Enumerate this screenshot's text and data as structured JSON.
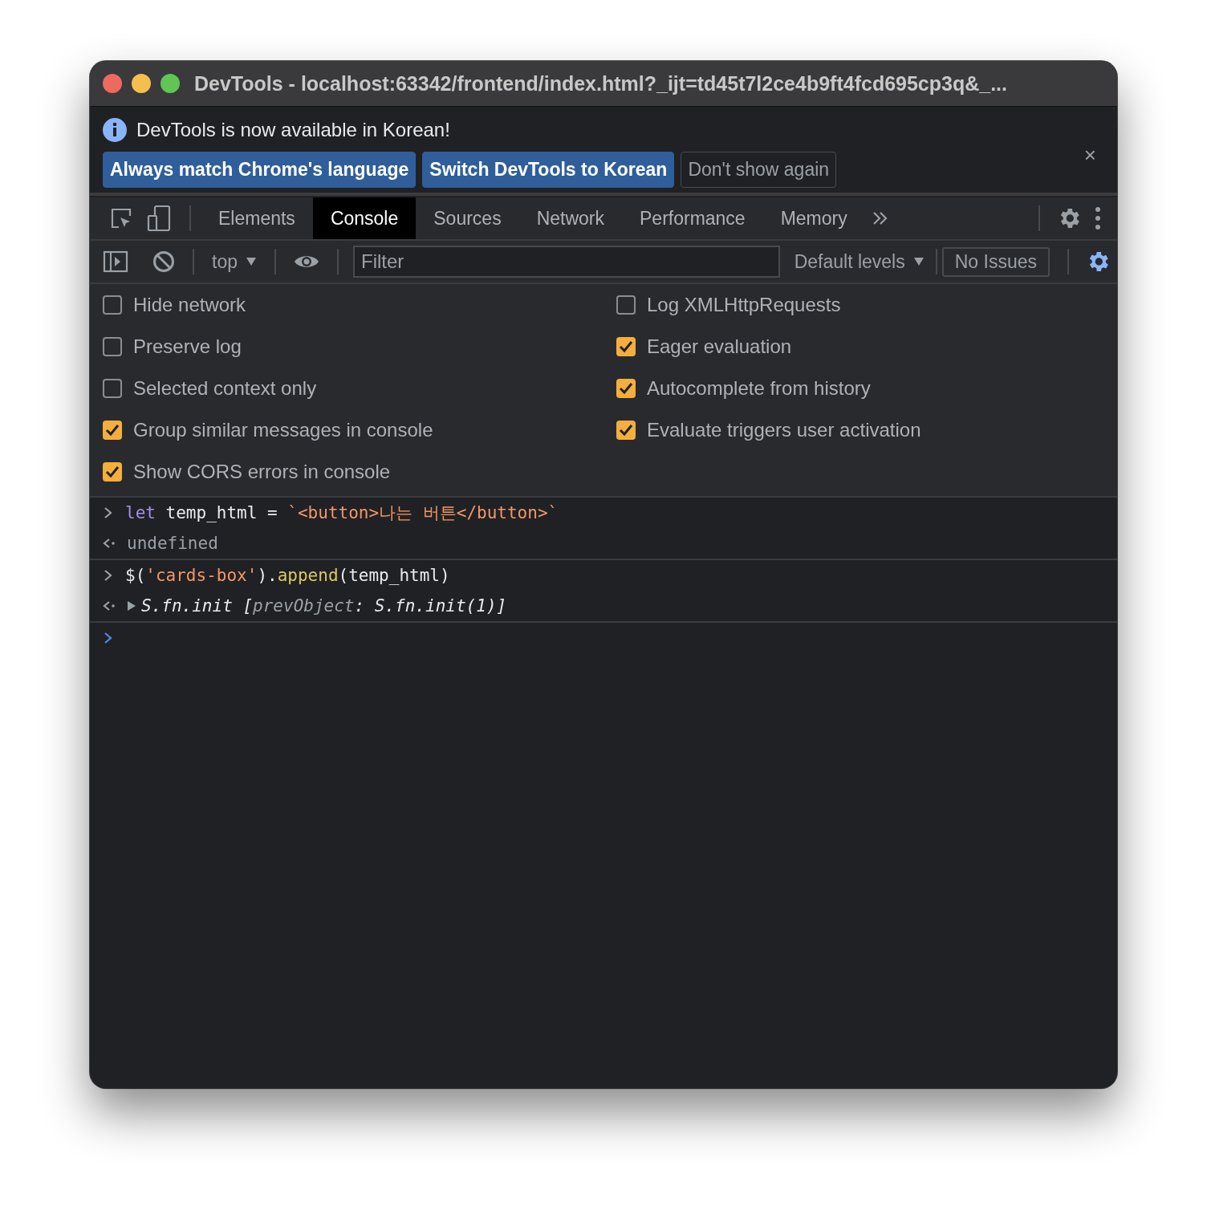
{
  "window": {
    "title": "DevTools - localhost:63342/frontend/index.html?_ijt=td45t7l2ce4b9ft4fcd695cp3q&_..."
  },
  "infobar": {
    "message": "DevTools is now available in Korean!",
    "buttons": [
      {
        "label": "Always match Chrome's language",
        "kind": "primary"
      },
      {
        "label": "Switch DevTools to Korean",
        "kind": "primary"
      },
      {
        "label": "Don't show again",
        "kind": "secondary"
      }
    ],
    "close": "×"
  },
  "tabs": [
    {
      "label": "Elements",
      "selected": false
    },
    {
      "label": "Console",
      "selected": true
    },
    {
      "label": "Sources",
      "selected": false
    },
    {
      "label": "Network",
      "selected": false
    },
    {
      "label": "Performance",
      "selected": false
    },
    {
      "label": "Memory",
      "selected": false
    }
  ],
  "toolbar": {
    "context": "top",
    "filter": {
      "placeholder": "Filter"
    },
    "levels": "Default levels",
    "issues": "No Issues"
  },
  "settings": {
    "left": [
      {
        "label": "Hide network",
        "checked": false
      },
      {
        "label": "Preserve log",
        "checked": false
      },
      {
        "label": "Selected context only",
        "checked": false
      },
      {
        "label": "Group similar messages in console",
        "checked": true
      },
      {
        "label": "Show CORS errors in console",
        "checked": true
      }
    ],
    "right": [
      {
        "label": "Log XMLHttpRequests",
        "checked": false
      },
      {
        "label": "Eager evaluation",
        "checked": true
      },
      {
        "label": "Autocomplete from history",
        "checked": true
      },
      {
        "label": "Evaluate triggers user activation",
        "checked": true
      }
    ]
  },
  "console": [
    {
      "kind": "input",
      "tokens": [
        {
          "kind": "keyword",
          "text": "let"
        },
        {
          "kind": "plain",
          "text": " temp_html = "
        },
        {
          "kind": "string",
          "text": "`<button>나는 버튼</button>`"
        }
      ]
    },
    {
      "kind": "output",
      "expandable": false,
      "tokens": [
        {
          "kind": "muted",
          "text": "undefined"
        }
      ]
    },
    {
      "kind": "input",
      "tokens": [
        {
          "kind": "plain",
          "text": "$("
        },
        {
          "kind": "string",
          "text": "'cards-box'"
        },
        {
          "kind": "plain",
          "text": ")."
        },
        {
          "kind": "method",
          "text": "append"
        },
        {
          "kind": "plain",
          "text": "(temp_html)"
        }
      ]
    },
    {
      "kind": "output",
      "expandable": true,
      "tokens": [
        {
          "kind": "italic",
          "text": "S.fn.init ["
        },
        {
          "kind": "italic-muted",
          "text": "prevObject"
        },
        {
          "kind": "italic",
          "text": ": S.fn.init(1)]"
        }
      ]
    }
  ]
}
